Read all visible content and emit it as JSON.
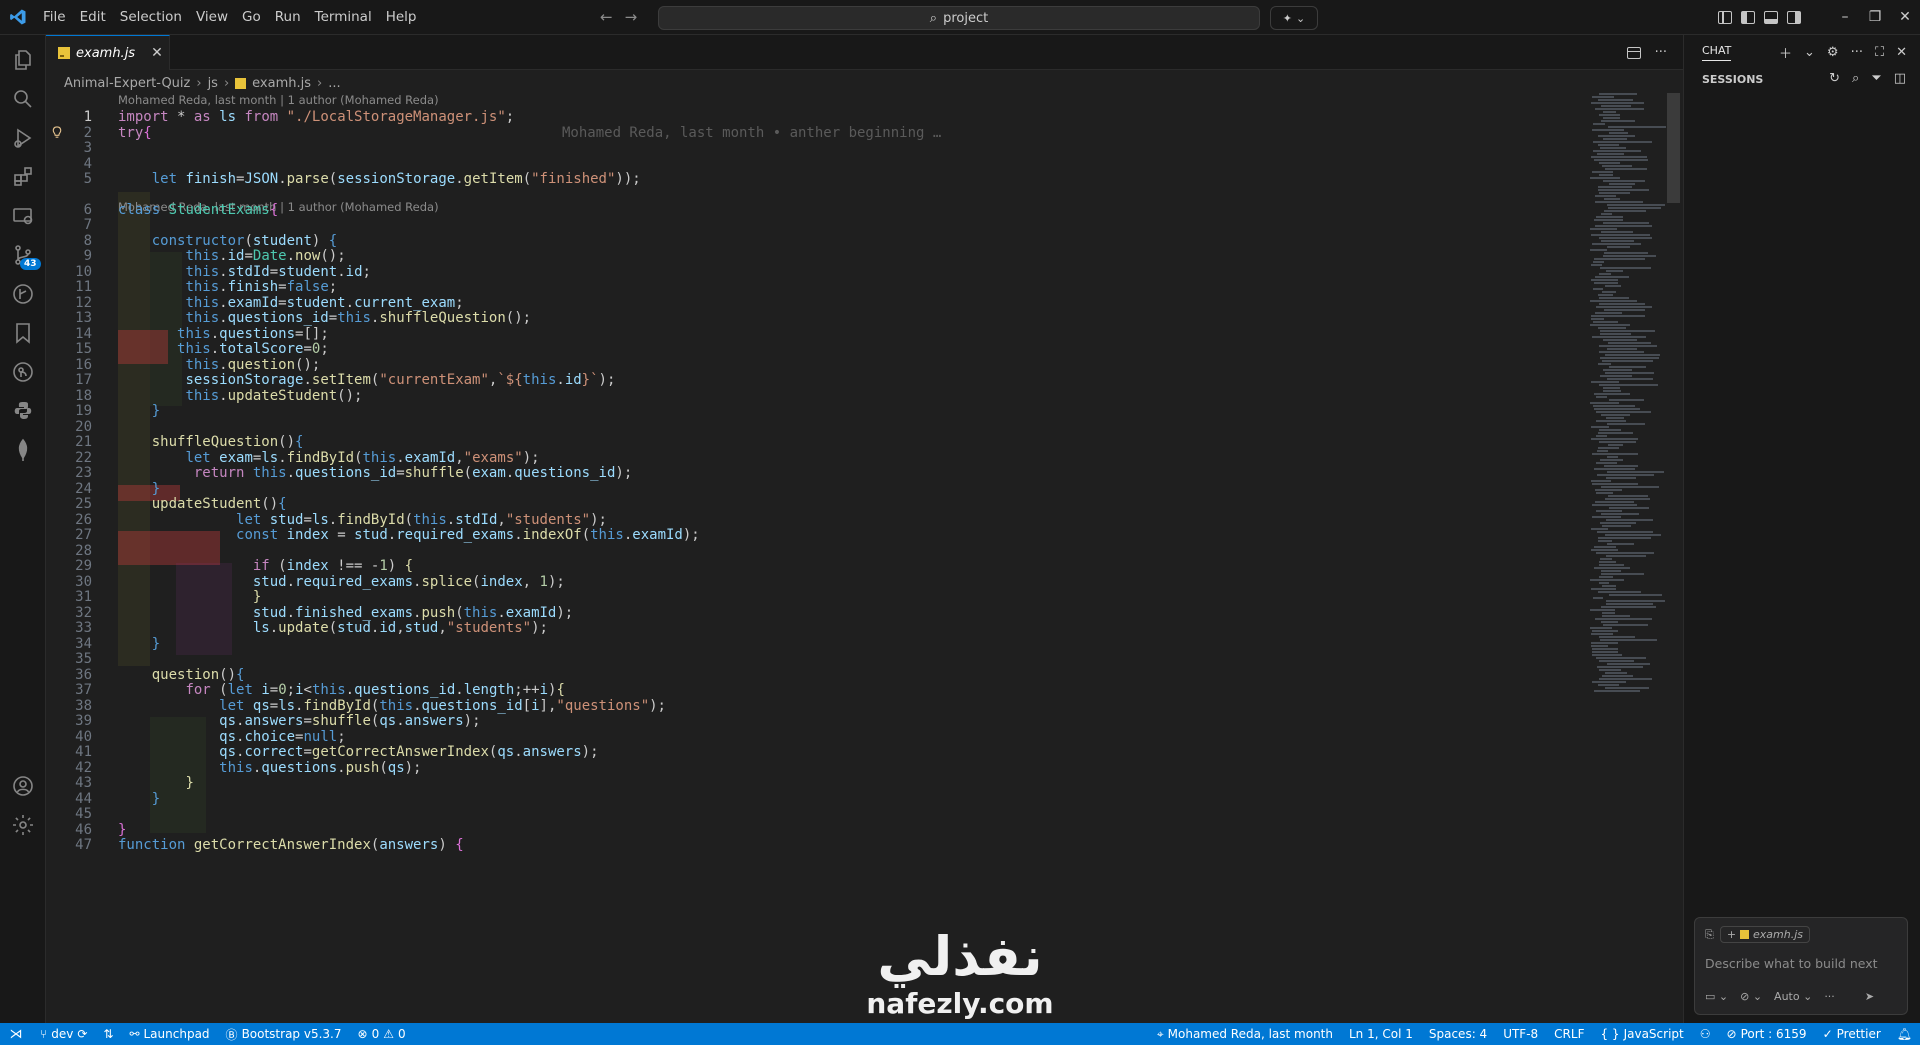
{
  "titlebar": {
    "menus": [
      "File",
      "Edit",
      "Selection",
      "View",
      "Go",
      "Run",
      "Terminal",
      "Help"
    ],
    "search_text": "project"
  },
  "activity_badge": "43",
  "editor": {
    "tab_name": "examh.js",
    "breadcrumb": [
      "Animal-Expert-Quiz",
      "js",
      "examh.js",
      "..."
    ],
    "blame_1": "Mohamed Reda, last month | 1 author (Mohamed Reda)",
    "blame_2": "Mohamed Reda, last month | 1 author (Mohamed Reda)",
    "ghost_text": "Mohamed Reda, last month • anther beginning …",
    "lines": [
      {
        "n": "1",
        "html": "<span class='kc'>import</span> * <span class='kc'>as</span> <span class='vr'>ls</span> <span class='kc'>from</span> <span class='st'>\"./LocalStorageManager.js\"</span>;"
      },
      {
        "n": "2",
        "html": "<span class='kc'>try</span><span class='pu'>{</span>"
      },
      {
        "n": "3",
        "html": ""
      },
      {
        "n": "4",
        "html": ""
      },
      {
        "n": "5",
        "html": "    <span class='kw'>let</span> <span class='vr'>finish</span>=<span class='vr'>JSON</span>.<span class='fn'>parse</span>(<span class='vr'>sessionStorage</span>.<span class='fn'>getItem</span>(<span class='st'>\"finished\"</span>));"
      },
      {
        "n": "6",
        "html": "<span class='kw'>class</span> <span class='cl'>StudentExams</span><span class='pu'>{</span>"
      },
      {
        "n": "7",
        "html": ""
      },
      {
        "n": "8",
        "html": "    <span class='kw'>constructor</span>(<span class='vr'>student</span>) <span class='kw'>{</span>"
      },
      {
        "n": "9",
        "html": "        <span class='kw'>this</span>.<span class='vr'>id</span>=<span class='cl'>Date</span>.<span class='fn'>now</span>();"
      },
      {
        "n": "10",
        "html": "        <span class='kw'>this</span>.<span class='vr'>stdId</span>=<span class='vr'>student</span>.<span class='vr'>id</span>;"
      },
      {
        "n": "11",
        "html": "        <span class='kw'>this</span>.<span class='vr'>finish</span>=<span class='kw'>false</span>;"
      },
      {
        "n": "12",
        "html": "        <span class='kw'>this</span>.<span class='vr'>examId</span>=<span class='vr'>student</span>.<span class='vr'>current_exam</span>;"
      },
      {
        "n": "13",
        "html": "        <span class='kw'>this</span>.<span class='vr'>questions_id</span>=<span class='kw'>this</span>.<span class='fn'>shuffleQuestion</span>();"
      },
      {
        "n": "14",
        "html": "       <span class='kw'>this</span>.<span class='vr'>questions</span>=[];"
      },
      {
        "n": "15",
        "html": "       <span class='kw'>this</span>.<span class='vr'>totalScore</span>=<span class='nm'>0</span>;"
      },
      {
        "n": "16",
        "html": "        <span class='kw'>this</span>.<span class='fn'>question</span>();"
      },
      {
        "n": "17",
        "html": "        <span class='vr'>sessionStorage</span>.<span class='fn'>setItem</span>(<span class='st'>\"currentExam\"</span>,<span class='st'>`${</span><span class='kw'>this</span>.<span class='vr'>id</span><span class='st'>}`</span>);"
      },
      {
        "n": "18",
        "html": "        <span class='kw'>this</span>.<span class='fn'>updateStudent</span>();"
      },
      {
        "n": "19",
        "html": "    <span class='kw'>}</span>"
      },
      {
        "n": "20",
        "html": ""
      },
      {
        "n": "21",
        "html": "    <span class='fn'>shuffleQuestion</span>()<span class='kw'>{</span>"
      },
      {
        "n": "22",
        "html": "        <span class='kw'>let</span> <span class='vr'>exam</span>=<span class='vr'>ls</span>.<span class='fn'>findById</span>(<span class='kw'>this</span>.<span class='vr'>examId</span>,<span class='st'>\"exams\"</span>);"
      },
      {
        "n": "23",
        "html": "         <span class='kc'>return</span> <span class='kw'>this</span>.<span class='vr'>questions_id</span>=<span class='fn'>shuffle</span>(<span class='vr'>exam</span>.<span class='vr'>questions_id</span>);"
      },
      {
        "n": "24",
        "html": "    <span class='kw'>}</span>"
      },
      {
        "n": "25",
        "html": "    <span class='fn'>updateStudent</span>()<span class='kw'>{</span>"
      },
      {
        "n": "26",
        "html": "              <span class='kw'>let</span> <span class='vr'>stud</span>=<span class='vr'>ls</span>.<span class='fn'>findById</span>(<span class='kw'>this</span>.<span class='vr'>stdId</span>,<span class='st'>\"students\"</span>);"
      },
      {
        "n": "27",
        "html": "              <span class='kw'>const</span> <span class='vr'>index</span> = <span class='vr'>stud</span>.<span class='vr'>required_exams</span>.<span class='fn'>indexOf</span>(<span class='kw'>this</span>.<span class='vr'>examId</span>);"
      },
      {
        "n": "28",
        "html": ""
      },
      {
        "n": "29",
        "html": "                <span class='kc'>if</span> (<span class='vr'>index</span> !== -<span class='nm'>1</span>) <span class='fn'>{</span>"
      },
      {
        "n": "30",
        "html": "                <span class='vr'>stud</span>.<span class='vr'>required_exams</span>.<span class='fn'>splice</span>(<span class='vr'>index</span>, <span class='nm'>1</span>);"
      },
      {
        "n": "31",
        "html": "                <span class='fn'>}</span>"
      },
      {
        "n": "32",
        "html": "                <span class='vr'>stud</span>.<span class='vr'>finished_exams</span>.<span class='fn'>push</span>(<span class='kw'>this</span>.<span class='vr'>examId</span>);"
      },
      {
        "n": "33",
        "html": "                <span class='vr'>ls</span>.<span class='fn'>update</span>(<span class='vr'>stud</span>.<span class='vr'>id</span>,<span class='vr'>stud</span>,<span class='st'>\"students\"</span>);"
      },
      {
        "n": "34",
        "html": "    <span class='kw'>}</span>"
      },
      {
        "n": "35",
        "html": ""
      },
      {
        "n": "36",
        "html": "    <span class='fn'>question</span>()<span class='kw'>{</span>"
      },
      {
        "n": "37",
        "html": "        <span class='kc'>for</span> (<span class='kw'>let</span> <span class='vr'>i</span>=<span class='nm'>0</span>;<span class='vr'>i</span>&lt;<span class='kw'>this</span>.<span class='vr'>questions_id</span>.<span class='vr'>length</span>;++<span class='vr'>i</span>)<span class='fn'>{</span>"
      },
      {
        "n": "38",
        "html": "            <span class='kw'>let</span> <span class='vr'>qs</span>=<span class='vr'>ls</span>.<span class='fn'>findById</span>(<span class='kw'>this</span>.<span class='vr'>questions_id</span>[<span class='vr'>i</span>],<span class='st'>\"questions\"</span>);"
      },
      {
        "n": "39",
        "html": "            <span class='vr'>qs</span>.<span class='vr'>answers</span>=<span class='fn'>shuffle</span>(<span class='vr'>qs</span>.<span class='vr'>answers</span>);"
      },
      {
        "n": "40",
        "html": "            <span class='vr'>qs</span>.<span class='vr'>choice</span>=<span class='kw'>null</span>;"
      },
      {
        "n": "41",
        "html": "            <span class='vr'>qs</span>.<span class='vr'>correct</span>=<span class='fn'>getCorrectAnswerIndex</span>(<span class='vr'>qs</span>.<span class='vr'>answers</span>);"
      },
      {
        "n": "42",
        "html": "            <span class='kw'>this</span>.<span class='vr'>questions</span>.<span class='fn'>push</span>(<span class='vr'>qs</span>);"
      },
      {
        "n": "43",
        "html": "        <span class='fn'>}</span>"
      },
      {
        "n": "44",
        "html": "    <span class='kw'>}</span>"
      },
      {
        "n": "45",
        "html": ""
      },
      {
        "n": "46",
        "html": "<span class='pu'>}</span>"
      },
      {
        "n": "47",
        "html": "<span class='kw'>function</span> <span class='fn'>getCorrectAnswerIndex</span>(<span class='vr'>answers</span>) <span class='pu'>{</span>"
      }
    ]
  },
  "chat": {
    "title": "CHAT",
    "sessions_label": "SESSIONS",
    "context_file": "examh.js",
    "placeholder": "Describe what to build next",
    "mode": "Auto"
  },
  "watermark": {
    "arabic": "نفذلي",
    "latin": "nafezly.com"
  },
  "statusbar": {
    "branch": "dev",
    "launchpad": "Launchpad",
    "bootstrap": "Bootstrap v5.3.7",
    "problems_errors": "0",
    "problems_warnings": "0",
    "blame": "Mohamed Reda, last month",
    "cursor": "Ln 1, Col 1",
    "spaces": "Spaces: 4",
    "encoding": "UTF-8",
    "eol": "CRLF",
    "language": "JavaScript",
    "port": "Port : 6159",
    "prettier": "Prettier"
  }
}
